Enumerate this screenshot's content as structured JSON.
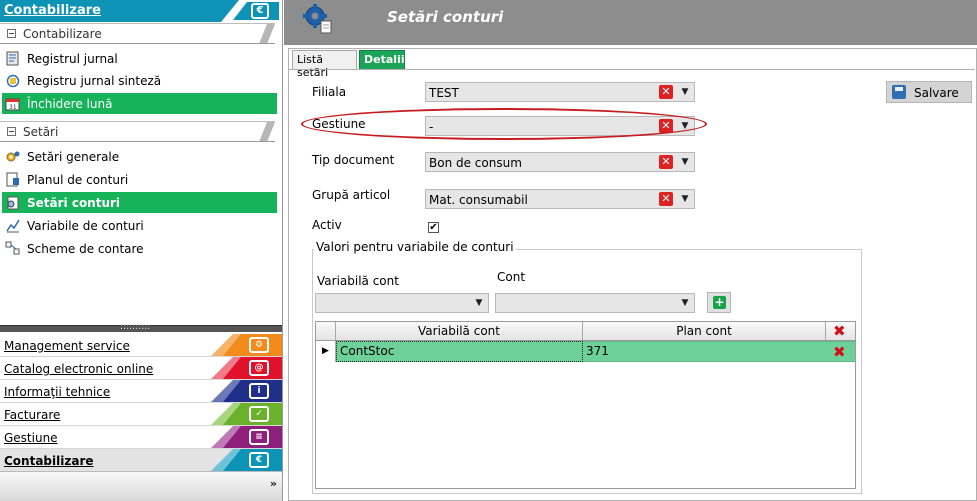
{
  "sidebar": {
    "header_label": "Contabilizare",
    "sections": [
      {
        "label": "Contabilizare"
      },
      {
        "label": "Setări"
      }
    ],
    "items": [
      {
        "label": "Registrul jurnal"
      },
      {
        "label": "Registru jurnal sinteză"
      },
      {
        "label": "Închidere lună"
      },
      {
        "label": "Setări generale"
      },
      {
        "label": "Planul de conturi"
      },
      {
        "label": "Setări conturi"
      },
      {
        "label": "Variabile de conturi"
      },
      {
        "label": "Scheme de contare"
      }
    ],
    "splitter_dots": "::::::::::",
    "modules": [
      {
        "label": "Management service",
        "color": "#f28a1c"
      },
      {
        "label": "Catalog electronic online",
        "color": "#e0112b"
      },
      {
        "label": "Informaţii tehnice",
        "color": "#1f2f8a"
      },
      {
        "label": "Facturare",
        "color": "#6bb22c"
      },
      {
        "label": "Gestiune",
        "color": "#8e1f7a"
      },
      {
        "label": "Contabilizare",
        "color": "#0c93b5"
      }
    ],
    "footer_chevron": "»"
  },
  "main": {
    "title": "Setări conturi",
    "tabs": [
      {
        "label": "Listă setări"
      },
      {
        "label": "Detalii*"
      }
    ],
    "form": {
      "filiala": {
        "label": "Filiala",
        "value": "TEST"
      },
      "gestiune": {
        "label": "Gestiune",
        "value": "-"
      },
      "tip_document": {
        "label": "Tip document",
        "value": "Bon de consum"
      },
      "grupa_articol": {
        "label": "Grupă articol",
        "value": "Mat. consumabil"
      },
      "activ": {
        "label": "Activ",
        "checked": true
      }
    },
    "save_label": "Salvare",
    "group": {
      "title": "Valori pentru variabile de conturi",
      "variabila_label": "Variabilă cont",
      "cont_label": "Cont"
    },
    "grid": {
      "columns": [
        "Variabilă cont",
        "Plan cont"
      ],
      "rows": [
        {
          "variabila": "ContStoc",
          "plan_cont": "371"
        }
      ]
    }
  },
  "colors": {
    "accent_teal": "#0c93b5",
    "selected_green": "#16b35a",
    "grid_row_green": "#6ed19a",
    "annotation_red": "#c61d22"
  }
}
